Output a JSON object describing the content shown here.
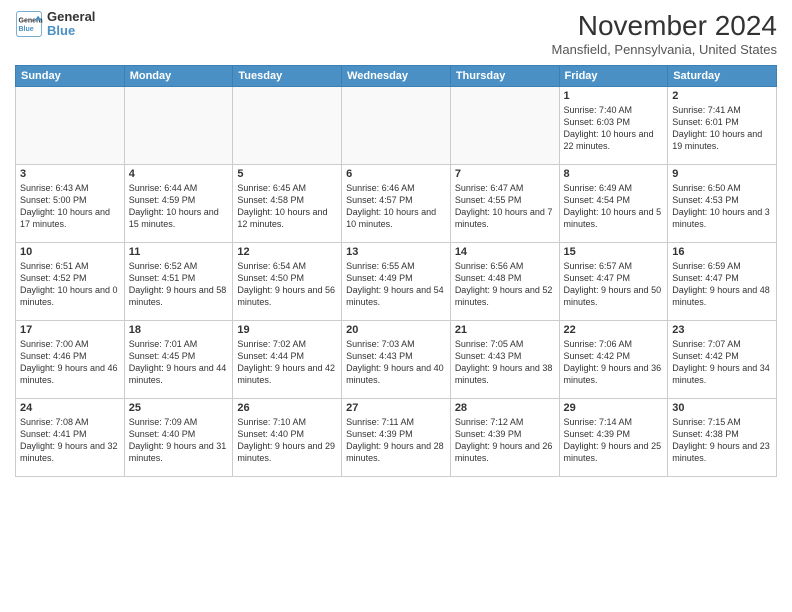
{
  "logo": {
    "line1": "General",
    "line2": "Blue"
  },
  "title": "November 2024",
  "location": "Mansfield, Pennsylvania, United States",
  "days": [
    "Sunday",
    "Monday",
    "Tuesday",
    "Wednesday",
    "Thursday",
    "Friday",
    "Saturday"
  ],
  "weeks": [
    [
      {
        "day": "",
        "info": ""
      },
      {
        "day": "",
        "info": ""
      },
      {
        "day": "",
        "info": ""
      },
      {
        "day": "",
        "info": ""
      },
      {
        "day": "",
        "info": ""
      },
      {
        "day": "1",
        "info": "Sunrise: 7:40 AM\nSunset: 6:03 PM\nDaylight: 10 hours and 22 minutes."
      },
      {
        "day": "2",
        "info": "Sunrise: 7:41 AM\nSunset: 6:01 PM\nDaylight: 10 hours and 19 minutes."
      }
    ],
    [
      {
        "day": "3",
        "info": "Sunrise: 6:43 AM\nSunset: 5:00 PM\nDaylight: 10 hours and 17 minutes."
      },
      {
        "day": "4",
        "info": "Sunrise: 6:44 AM\nSunset: 4:59 PM\nDaylight: 10 hours and 15 minutes."
      },
      {
        "day": "5",
        "info": "Sunrise: 6:45 AM\nSunset: 4:58 PM\nDaylight: 10 hours and 12 minutes."
      },
      {
        "day": "6",
        "info": "Sunrise: 6:46 AM\nSunset: 4:57 PM\nDaylight: 10 hours and 10 minutes."
      },
      {
        "day": "7",
        "info": "Sunrise: 6:47 AM\nSunset: 4:55 PM\nDaylight: 10 hours and 7 minutes."
      },
      {
        "day": "8",
        "info": "Sunrise: 6:49 AM\nSunset: 4:54 PM\nDaylight: 10 hours and 5 minutes."
      },
      {
        "day": "9",
        "info": "Sunrise: 6:50 AM\nSunset: 4:53 PM\nDaylight: 10 hours and 3 minutes."
      }
    ],
    [
      {
        "day": "10",
        "info": "Sunrise: 6:51 AM\nSunset: 4:52 PM\nDaylight: 10 hours and 0 minutes."
      },
      {
        "day": "11",
        "info": "Sunrise: 6:52 AM\nSunset: 4:51 PM\nDaylight: 9 hours and 58 minutes."
      },
      {
        "day": "12",
        "info": "Sunrise: 6:54 AM\nSunset: 4:50 PM\nDaylight: 9 hours and 56 minutes."
      },
      {
        "day": "13",
        "info": "Sunrise: 6:55 AM\nSunset: 4:49 PM\nDaylight: 9 hours and 54 minutes."
      },
      {
        "day": "14",
        "info": "Sunrise: 6:56 AM\nSunset: 4:48 PM\nDaylight: 9 hours and 52 minutes."
      },
      {
        "day": "15",
        "info": "Sunrise: 6:57 AM\nSunset: 4:47 PM\nDaylight: 9 hours and 50 minutes."
      },
      {
        "day": "16",
        "info": "Sunrise: 6:59 AM\nSunset: 4:47 PM\nDaylight: 9 hours and 48 minutes."
      }
    ],
    [
      {
        "day": "17",
        "info": "Sunrise: 7:00 AM\nSunset: 4:46 PM\nDaylight: 9 hours and 46 minutes."
      },
      {
        "day": "18",
        "info": "Sunrise: 7:01 AM\nSunset: 4:45 PM\nDaylight: 9 hours and 44 minutes."
      },
      {
        "day": "19",
        "info": "Sunrise: 7:02 AM\nSunset: 4:44 PM\nDaylight: 9 hours and 42 minutes."
      },
      {
        "day": "20",
        "info": "Sunrise: 7:03 AM\nSunset: 4:43 PM\nDaylight: 9 hours and 40 minutes."
      },
      {
        "day": "21",
        "info": "Sunrise: 7:05 AM\nSunset: 4:43 PM\nDaylight: 9 hours and 38 minutes."
      },
      {
        "day": "22",
        "info": "Sunrise: 7:06 AM\nSunset: 4:42 PM\nDaylight: 9 hours and 36 minutes."
      },
      {
        "day": "23",
        "info": "Sunrise: 7:07 AM\nSunset: 4:42 PM\nDaylight: 9 hours and 34 minutes."
      }
    ],
    [
      {
        "day": "24",
        "info": "Sunrise: 7:08 AM\nSunset: 4:41 PM\nDaylight: 9 hours and 32 minutes."
      },
      {
        "day": "25",
        "info": "Sunrise: 7:09 AM\nSunset: 4:40 PM\nDaylight: 9 hours and 31 minutes."
      },
      {
        "day": "26",
        "info": "Sunrise: 7:10 AM\nSunset: 4:40 PM\nDaylight: 9 hours and 29 minutes."
      },
      {
        "day": "27",
        "info": "Sunrise: 7:11 AM\nSunset: 4:39 PM\nDaylight: 9 hours and 28 minutes."
      },
      {
        "day": "28",
        "info": "Sunrise: 7:12 AM\nSunset: 4:39 PM\nDaylight: 9 hours and 26 minutes."
      },
      {
        "day": "29",
        "info": "Sunrise: 7:14 AM\nSunset: 4:39 PM\nDaylight: 9 hours and 25 minutes."
      },
      {
        "day": "30",
        "info": "Sunrise: 7:15 AM\nSunset: 4:38 PM\nDaylight: 9 hours and 23 minutes."
      }
    ]
  ]
}
